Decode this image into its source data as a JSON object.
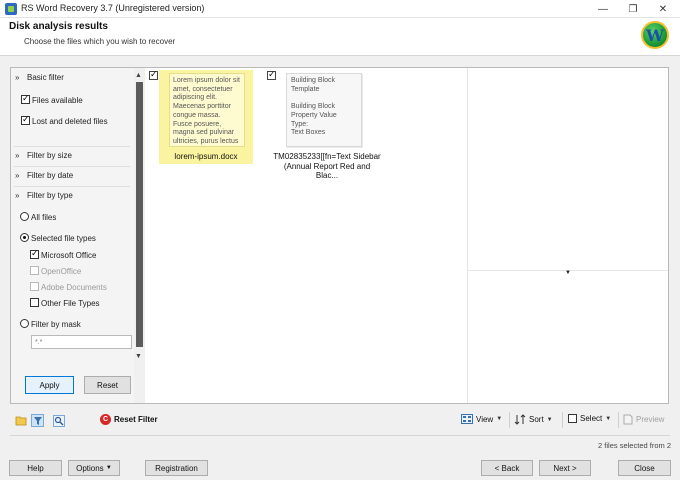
{
  "window": {
    "title": "RS Word Recovery 3.7 (Unregistered version)",
    "minimize_glyph": "—",
    "maximize_glyph": "❐",
    "close_glyph": "✕"
  },
  "header": {
    "title": "Disk analysis results",
    "subtitle": "Choose the files which you wish to recover",
    "logo_letter": "W"
  },
  "filter_panel": {
    "basic_filter": {
      "label": "Basic filter",
      "expanded": true,
      "options": [
        {
          "label": "Files available",
          "checked": true
        },
        {
          "label": "Lost and deleted files",
          "checked": true
        }
      ]
    },
    "filter_by_size": {
      "label": "Filter by size",
      "expanded": false
    },
    "filter_by_date": {
      "label": "Filter by date",
      "expanded": false
    },
    "filter_by_type": {
      "label": "Filter by type",
      "expanded": true,
      "all_files": {
        "label": "All files",
        "selected": false
      },
      "selected_file_types": {
        "label": "Selected file types",
        "selected": true
      },
      "types": [
        {
          "label": "Microsoft Office",
          "checked": true,
          "enabled": true
        },
        {
          "label": "OpenOffice",
          "checked": false,
          "enabled": false
        },
        {
          "label": "Adobe Documents",
          "checked": false,
          "enabled": false
        },
        {
          "label": "Other File Types",
          "checked": false,
          "enabled": true
        }
      ],
      "filter_by_mask": {
        "label": "Filter by mask",
        "selected": false,
        "placeholder": "*.*"
      }
    },
    "apply_label": "Apply",
    "reset_label": "Reset"
  },
  "files": [
    {
      "name": "lorem-ipsum.docx",
      "checked": true,
      "selected": true,
      "preview_text": "Lorem ipsum dolor sit amet, consectetuer adipiscing elit. Maecenas porttitor congue massa. Fusce posuere, magna sed pulvinar ultricies, purus lectus"
    },
    {
      "name": "TM02835233[[fn=Text Sidebar (Annual Report Red and Blac...",
      "checked": true,
      "selected": false,
      "preview_text": "Building Block Template\n\nBuilding Block Property Value\nType:\nText Boxes"
    }
  ],
  "toolbar": {
    "reset_filter_label": "Reset Filter",
    "view_label": "View",
    "sort_label": "Sort",
    "select_label": "Select",
    "preview_label": "Preview"
  },
  "status": {
    "selection_text": "2 files selected from 2"
  },
  "footer": {
    "help_label": "Help",
    "options_label": "Options",
    "registration_label": "Registration",
    "back_label": "< Back",
    "next_label": "Next >",
    "close_label": "Close"
  },
  "colors": {
    "selection_highlight": "#faf3a0",
    "accent": "#0078d7",
    "reset_icon": "#d62828"
  }
}
